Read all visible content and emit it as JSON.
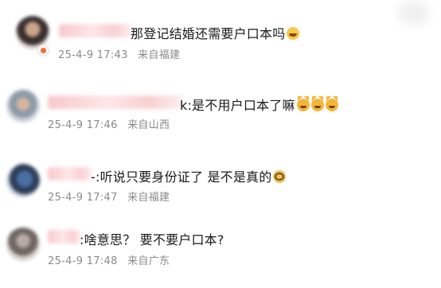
{
  "comments": [
    {
      "text": "那登记结婚还需要户口本吗",
      "emoji": "laughing-emoji",
      "date": "25-4-9",
      "time": "17:43",
      "location": "来自福建"
    },
    {
      "text": "k:是不用户口本了嘛",
      "emoji": "cat-laugh-emoji",
      "date": "25-4-9",
      "time": "17:46",
      "location": "来自山西"
    },
    {
      "text": "-:听说只要身份证了 是不是真的",
      "emoji": "dizzy-emoji",
      "date": "25-4-9",
      "time": "17:47",
      "location": "来自福建"
    },
    {
      "text": ":啥意思？ 要不要户口本?",
      "date": "25-4-9",
      "time": "17:48",
      "location": "来自广东"
    }
  ],
  "colors": {
    "text": "#1a1a1a",
    "meta": "#8a8a8a",
    "name_blur": "#f8c9cc"
  }
}
